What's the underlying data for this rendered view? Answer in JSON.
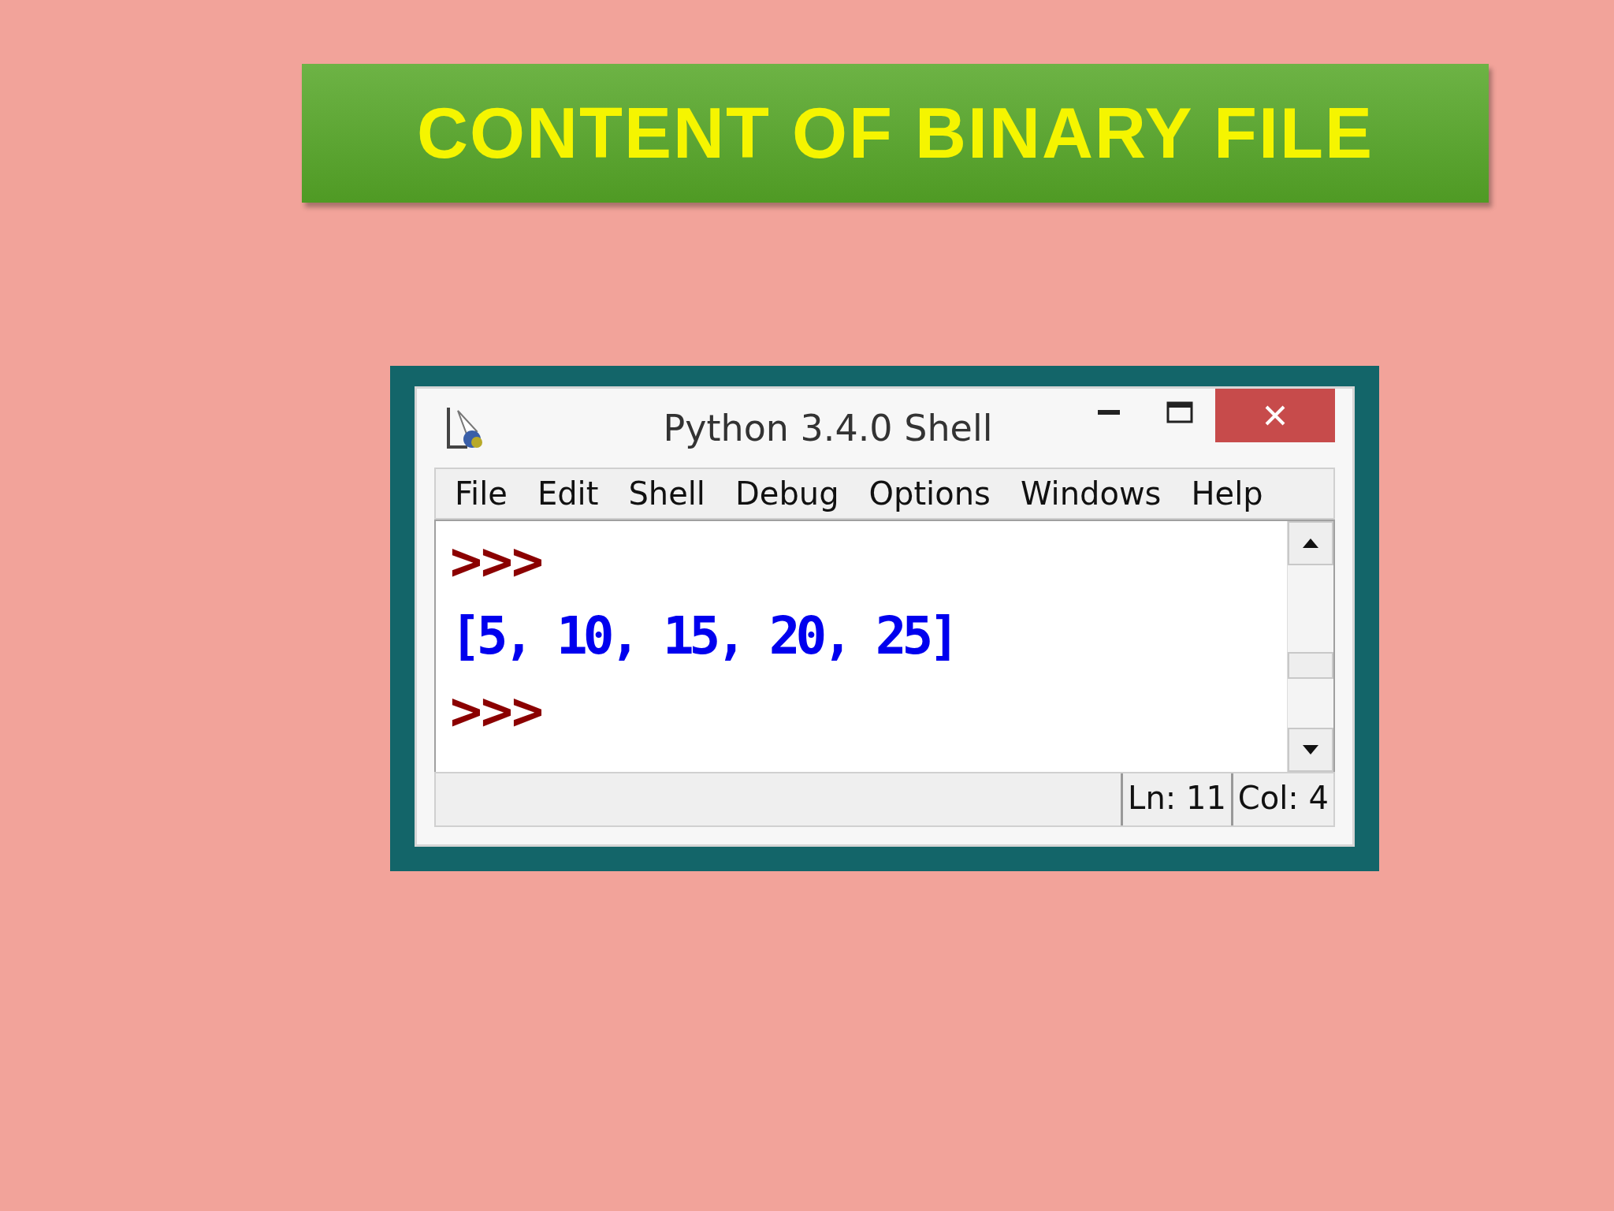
{
  "slide": {
    "title": "CONTENT OF BINARY FILE"
  },
  "window": {
    "title": "Python 3.4.0 Shell",
    "controls": [
      {
        "kind": "minimize"
      },
      {
        "kind": "maximize"
      },
      {
        "kind": "close"
      }
    ]
  },
  "menu": [
    "File",
    "Edit",
    "Shell",
    "Debug",
    "Options",
    "Windows",
    "Help"
  ],
  "shell": [
    {
      "kind": "prompt",
      "text": ">>>"
    },
    {
      "kind": "output",
      "text": "[5, 10, 15, 20, 25]"
    },
    {
      "kind": "prompt",
      "text": ">>>"
    }
  ],
  "status_bar": [
    "Ln: 11",
    "Col: 4"
  ]
}
